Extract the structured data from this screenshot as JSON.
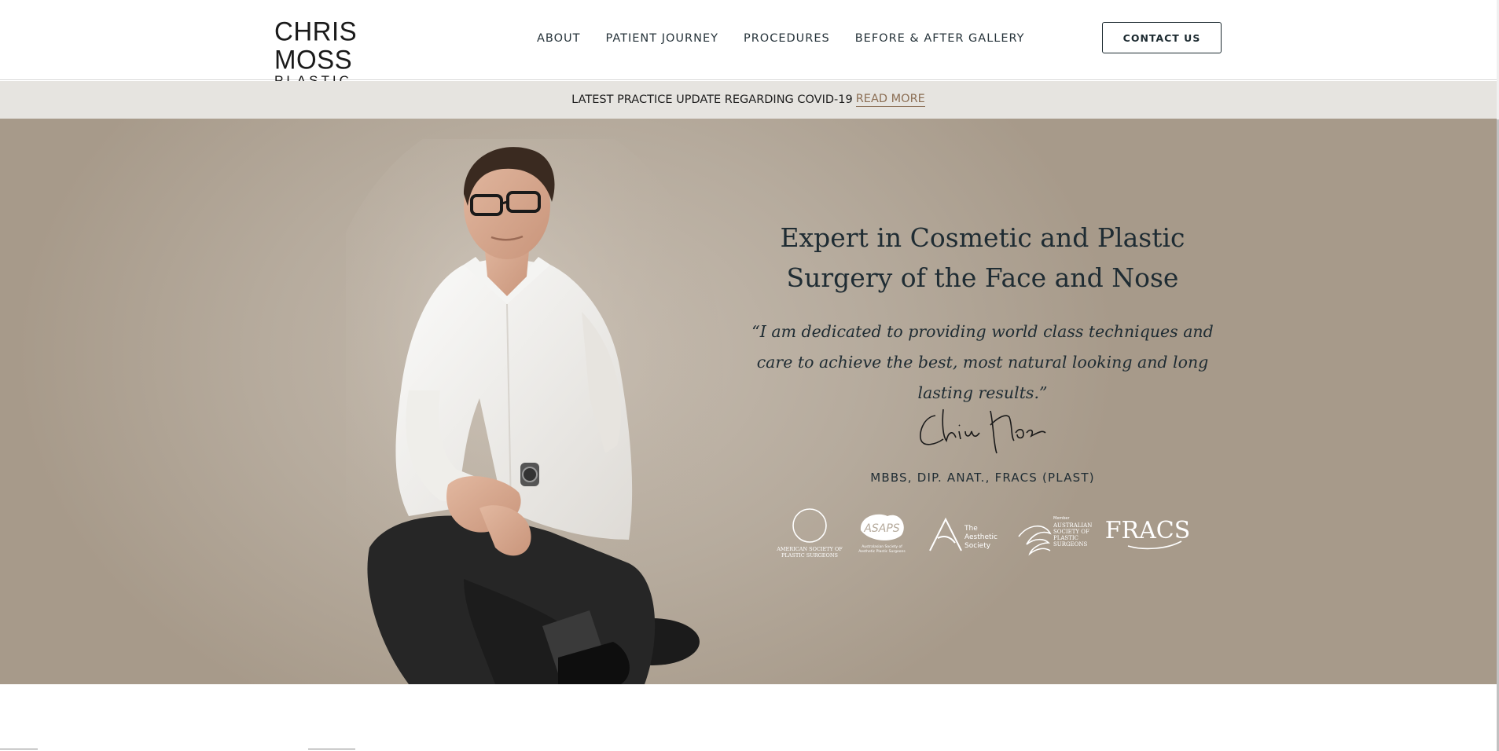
{
  "logo": {
    "name": "CHRIS MOSS",
    "subtitle": "PLASTIC SURGEON"
  },
  "nav": {
    "items": [
      {
        "label": "ABOUT"
      },
      {
        "label": "PATIENT JOURNEY"
      },
      {
        "label": "PROCEDURES"
      },
      {
        "label": "BEFORE & AFTER GALLERY"
      }
    ]
  },
  "contact_button": "CONTACT US",
  "notice": {
    "text": "LATEST PRACTICE UPDATE REGARDING COVID-19",
    "link": "READ MORE"
  },
  "hero": {
    "title": "Expert in Cosmetic and Plastic Surgery of the Face and Nose",
    "quote": "“I am dedicated to providing world class techniques and care to achieve the best, most natural looking and long lasting results.”",
    "signature": "Chris Moss",
    "credentials": "MBBS, DIP. ANAT., FRACS (PLAST)",
    "associations": [
      {
        "name": "American Society of Plastic Surgeons",
        "line1": "AMERICAN SOCIETY OF",
        "line2": "PLASTIC SURGEONS"
      },
      {
        "name": "ASAPS",
        "line1": "Australasian Society of",
        "line2": "Aesthetic Plastic Surgeons"
      },
      {
        "name": "The Aesthetic Society",
        "line1": "The",
        "line2": "Aesthetic",
        "line3": "Society"
      },
      {
        "name": "Australian Society of Plastic Surgeons",
        "line0": "Member",
        "line1": "AUSTRALIAN",
        "line2": "SOCIETY OF",
        "line3": "PLASTIC",
        "line4": "SURGEONS"
      },
      {
        "name": "FRACS"
      }
    ]
  },
  "colors": {
    "hero_bg": "#b6ab9d",
    "text_dark": "#1f2c33",
    "link_accent": "#8c6f55",
    "notice_bg": "#e6e4e0"
  }
}
